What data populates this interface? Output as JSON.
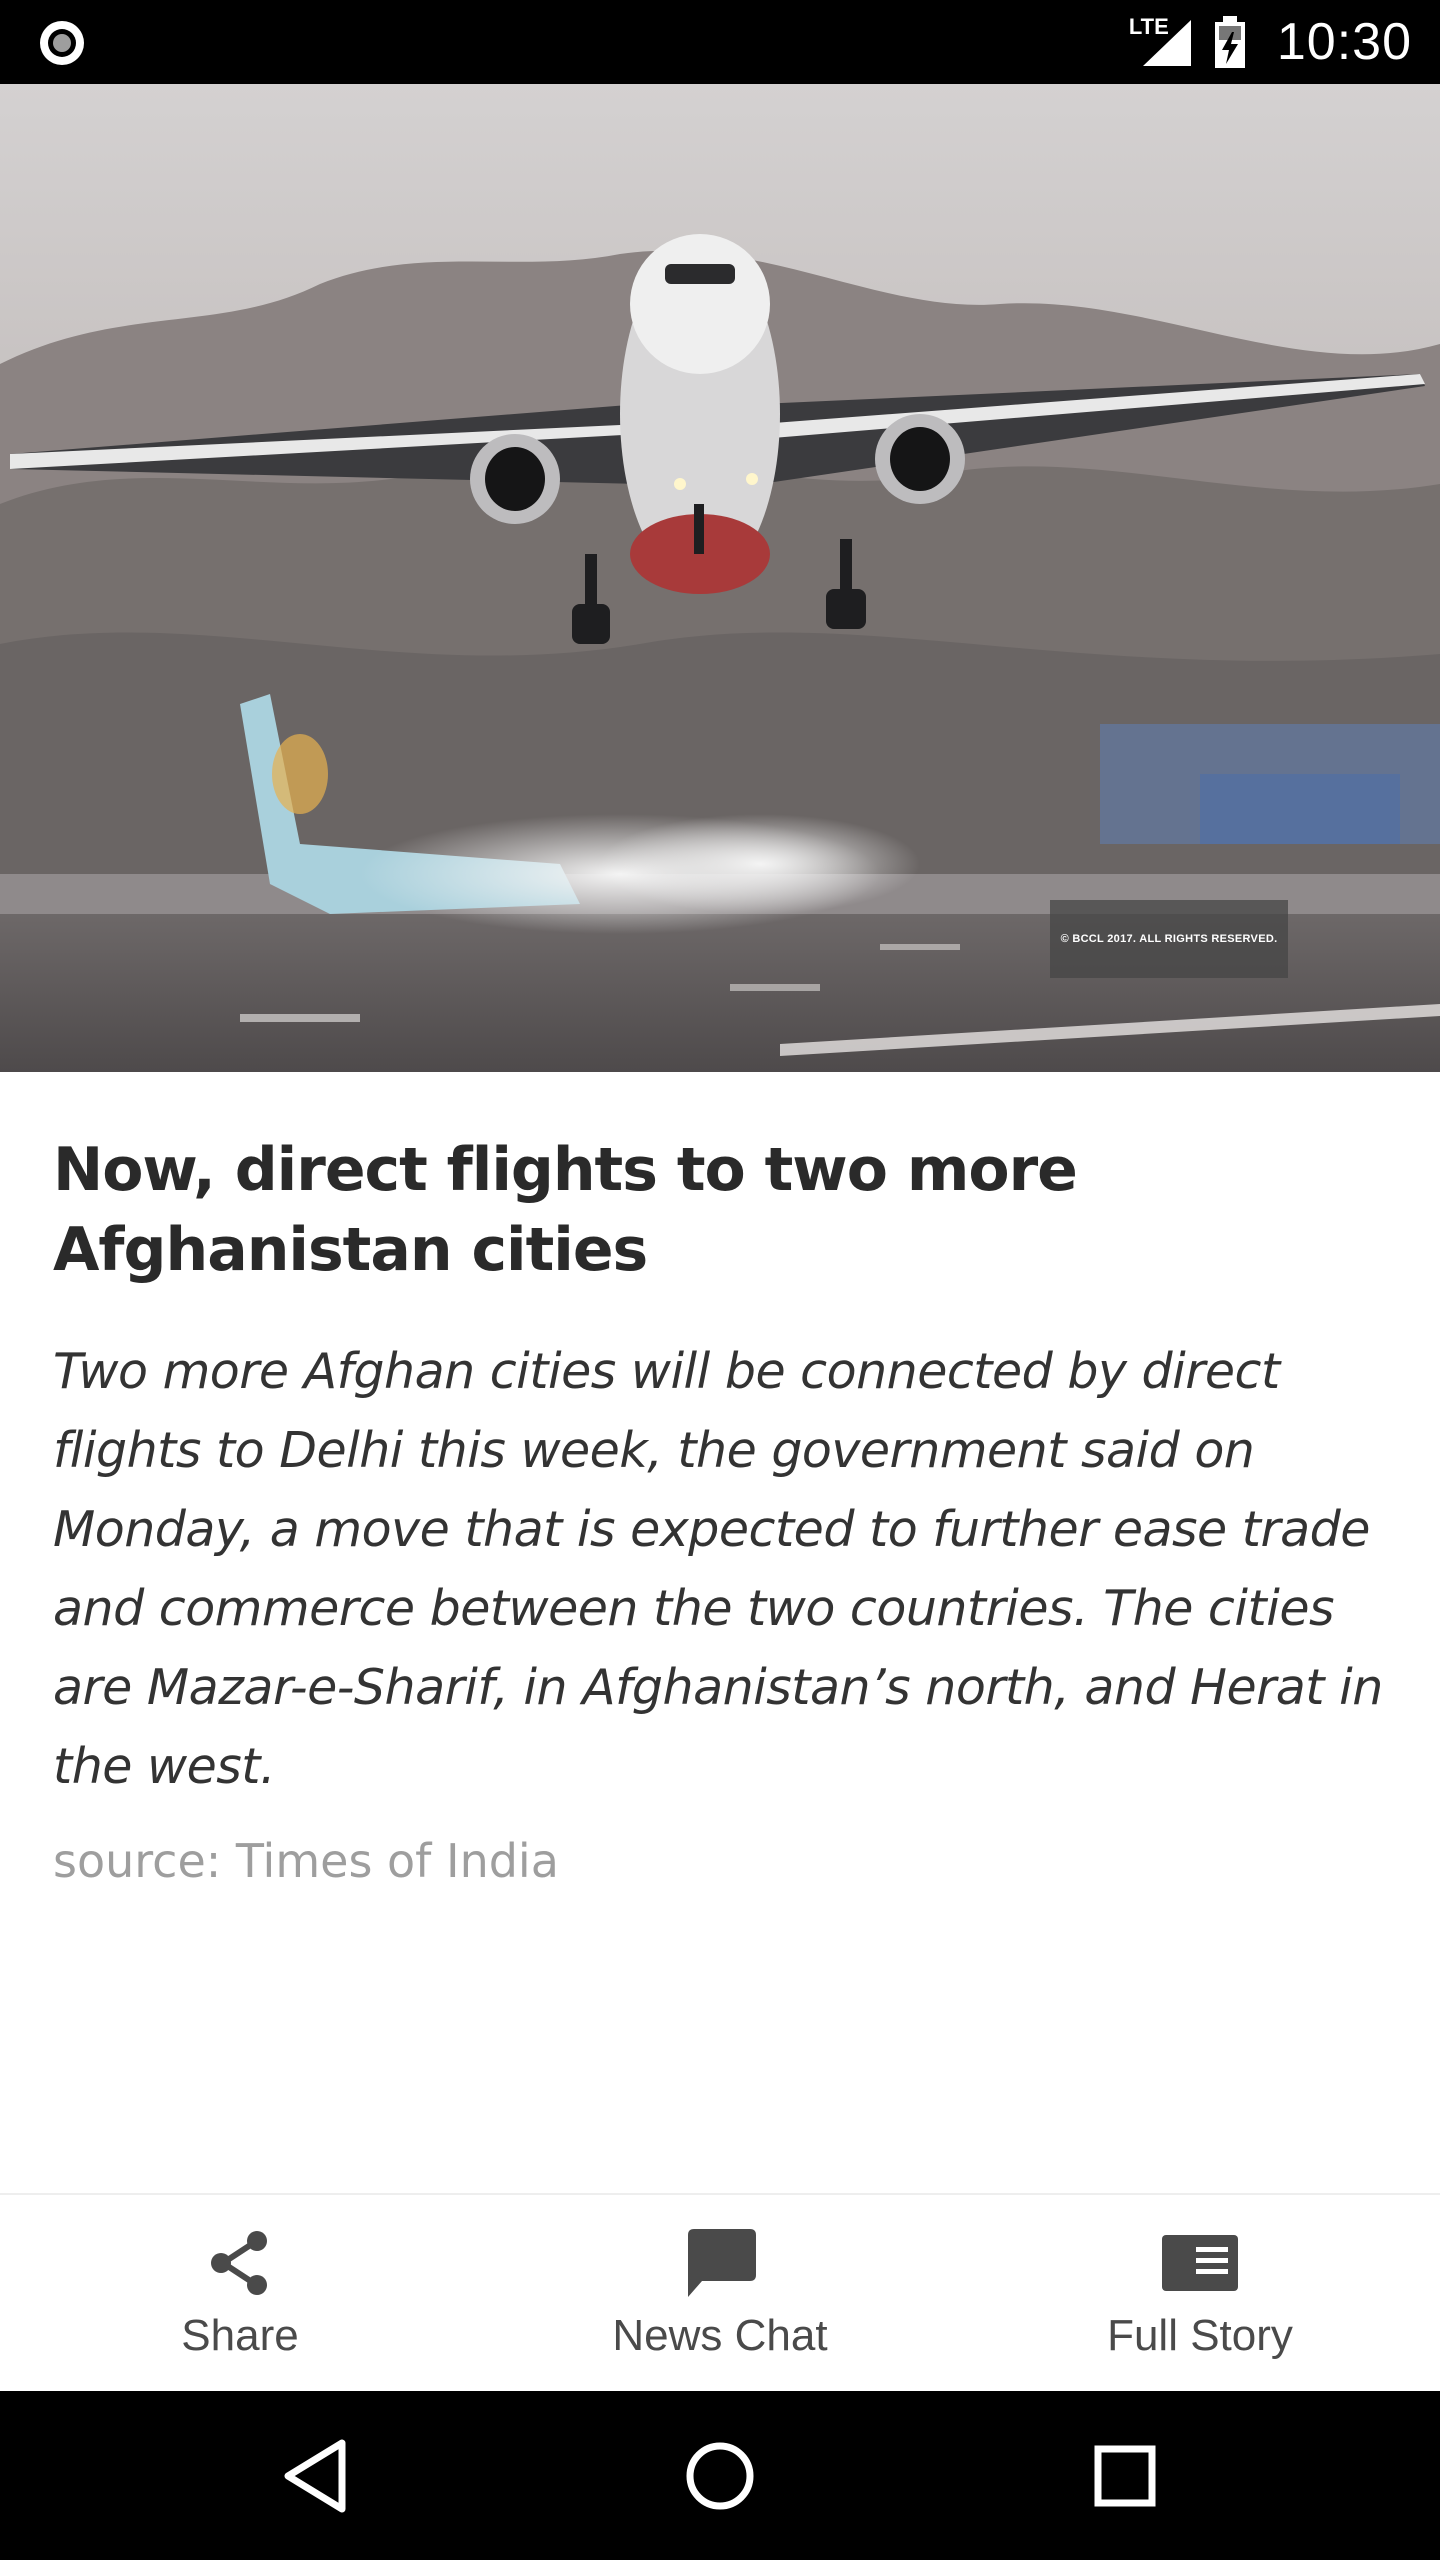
{
  "status_bar": {
    "network": "LTE",
    "time": "10:30",
    "icons": [
      "notification-dot-icon",
      "lte-signal-icon",
      "battery-charging-icon"
    ]
  },
  "hero": {
    "watermark": "© BCCL 2017. ALL RIGHTS RESERVED."
  },
  "article": {
    "headline": "Now, direct flights to two more Afghanistan cities",
    "summary": "Two more Afghan cities will be connected by direct flights to Delhi this week, the government said on Monday, a move that is expected to further ease trade and commerce between the two countries. The cities are Mazar-e-Sharif, in Afghanistan’s north, and Herat in the west.",
    "source": "source: Times of India"
  },
  "actions": {
    "share_label": "Share",
    "chat_label": "News Chat",
    "story_label": "Full Story"
  },
  "colors": {
    "status_bar_bg": "#000000",
    "headline": "#2a2a2a",
    "summary": "#333333",
    "source": "#9e9e9e",
    "action_icon": "#4a4a4a"
  }
}
